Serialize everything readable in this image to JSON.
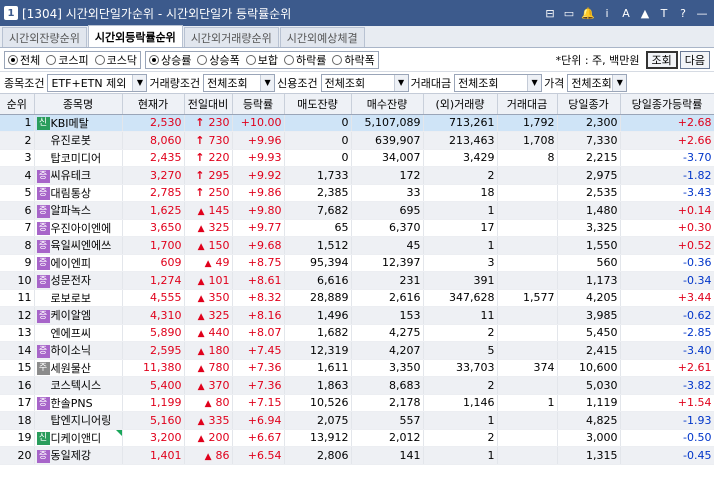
{
  "window": {
    "icon_label": "1",
    "title": "[1304] 시간외단일가순위 - 시간외단일가 등락률순위",
    "buttons": [
      "⊟",
      "▭",
      "🔔",
      "i",
      "A",
      "▲",
      "T",
      "?",
      "—"
    ]
  },
  "tabs": [
    {
      "label": "시간외잔량순위",
      "active": false
    },
    {
      "label": "시간외등락률순위",
      "active": true
    },
    {
      "label": "시간외거래량순위",
      "active": false
    },
    {
      "label": "시간외예상체결",
      "active": false
    }
  ],
  "market_filter": [
    {
      "label": "전체",
      "on": true
    },
    {
      "label": "코스피",
      "on": false
    },
    {
      "label": "코스닥",
      "on": false
    }
  ],
  "direction_filter": [
    {
      "label": "상승률",
      "on": true
    },
    {
      "label": "상승폭",
      "on": false
    },
    {
      "label": "보합",
      "on": false
    },
    {
      "label": "하락률",
      "on": false
    },
    {
      "label": "하락폭",
      "on": false
    }
  ],
  "unit_text": "*단위 : 주, 백만원",
  "query_button": "조회",
  "next_button": "다음",
  "conditions": {
    "item_label": "종목조건",
    "item_value": "ETF+ETN 제외",
    "volume_label": "거래량조건",
    "volume_value": "전체조회",
    "credit_label": "신용조건",
    "credit_value": "전체조회",
    "amount_label": "거래대금",
    "amount_value": "전체조회",
    "price_label": "가격",
    "price_value": "전체조회"
  },
  "columns": [
    "순위",
    "종목명",
    "현재가",
    "전일대비",
    "등락률",
    "매도잔량",
    "매수잔량",
    "(외)거래량",
    "거래대금",
    "당일종가",
    "당일종가등락률"
  ],
  "rows": [
    {
      "rank": "1",
      "badge": "신",
      "name": "KBI메탈",
      "price": "2,530",
      "sym": "↑",
      "change": "230",
      "rate": "+10.00",
      "ask": "0",
      "bid": "5,107,089",
      "vol": "713,261",
      "amt": "1,792",
      "close": "2,300",
      "crate": "+2.68",
      "cdir": "up"
    },
    {
      "rank": "2",
      "badge": "",
      "name": "유진로봇",
      "price": "8,060",
      "sym": "↑",
      "change": "730",
      "rate": "+9.96",
      "ask": "0",
      "bid": "639,907",
      "vol": "213,463",
      "amt": "1,708",
      "close": "7,330",
      "crate": "+2.66",
      "cdir": "up"
    },
    {
      "rank": "3",
      "badge": "",
      "name": "탑코미디어",
      "price": "2,435",
      "sym": "↑",
      "change": "220",
      "rate": "+9.93",
      "ask": "0",
      "bid": "34,007",
      "vol": "3,429",
      "amt": "8",
      "close": "2,215",
      "crate": "-3.70",
      "cdir": "dn"
    },
    {
      "rank": "4",
      "badge": "증",
      "name": "씨유테크",
      "price": "3,270",
      "sym": "↑",
      "change": "295",
      "rate": "+9.92",
      "ask": "1,733",
      "bid": "172",
      "vol": "2",
      "amt": "",
      "close": "2,975",
      "crate": "-1.82",
      "cdir": "dn"
    },
    {
      "rank": "5",
      "badge": "증",
      "name": "대림통상",
      "price": "2,785",
      "sym": "↑",
      "change": "250",
      "rate": "+9.86",
      "ask": "2,385",
      "bid": "33",
      "vol": "18",
      "amt": "",
      "close": "2,535",
      "crate": "-3.43",
      "cdir": "dn"
    },
    {
      "rank": "6",
      "badge": "증",
      "name": "알파녹스",
      "price": "1,625",
      "sym": "▲",
      "change": "145",
      "rate": "+9.80",
      "ask": "7,682",
      "bid": "695",
      "vol": "1",
      "amt": "",
      "close": "1,480",
      "crate": "+0.14",
      "cdir": "up"
    },
    {
      "rank": "7",
      "badge": "증",
      "name": "우진아이엔에",
      "price": "3,650",
      "sym": "▲",
      "change": "325",
      "rate": "+9.77",
      "ask": "65",
      "bid": "6,370",
      "vol": "17",
      "amt": "",
      "close": "3,325",
      "crate": "+0.30",
      "cdir": "up"
    },
    {
      "rank": "8",
      "badge": "증",
      "name": "육일씨엔에쓰",
      "price": "1,700",
      "sym": "▲",
      "change": "150",
      "rate": "+9.68",
      "ask": "1,512",
      "bid": "45",
      "vol": "1",
      "amt": "",
      "close": "1,550",
      "crate": "+0.52",
      "cdir": "up"
    },
    {
      "rank": "9",
      "badge": "증",
      "name": "에이엔피",
      "price": "609",
      "sym": "▲",
      "change": "49",
      "rate": "+8.75",
      "ask": "95,394",
      "bid": "12,397",
      "vol": "3",
      "amt": "",
      "close": "560",
      "crate": "-0.36",
      "cdir": "dn"
    },
    {
      "rank": "10",
      "badge": "증",
      "name": "성문전자",
      "price": "1,274",
      "sym": "▲",
      "change": "101",
      "rate": "+8.61",
      "ask": "6,616",
      "bid": "231",
      "vol": "391",
      "amt": "",
      "close": "1,173",
      "crate": "-0.34",
      "cdir": "dn"
    },
    {
      "rank": "11",
      "badge": "",
      "name": "로보로보",
      "price": "4,555",
      "sym": "▲",
      "change": "350",
      "rate": "+8.32",
      "ask": "28,889",
      "bid": "2,616",
      "vol": "347,628",
      "amt": "1,577",
      "close": "4,205",
      "crate": "+3.44",
      "cdir": "up"
    },
    {
      "rank": "12",
      "badge": "증",
      "name": "케이알엠",
      "price": "4,310",
      "sym": "▲",
      "change": "325",
      "rate": "+8.16",
      "ask": "1,496",
      "bid": "153",
      "vol": "11",
      "amt": "",
      "close": "3,985",
      "crate": "-0.62",
      "cdir": "dn"
    },
    {
      "rank": "13",
      "badge": "",
      "name": "엔에프씨",
      "price": "5,890",
      "sym": "▲",
      "change": "440",
      "rate": "+8.07",
      "ask": "1,682",
      "bid": "4,275",
      "vol": "2",
      "amt": "",
      "close": "5,450",
      "crate": "-2.85",
      "cdir": "dn"
    },
    {
      "rank": "14",
      "badge": "증",
      "name": "하이소닉",
      "price": "2,595",
      "sym": "▲",
      "change": "180",
      "rate": "+7.45",
      "ask": "12,319",
      "bid": "4,207",
      "vol": "5",
      "amt": "",
      "close": "2,415",
      "crate": "-3.40",
      "cdir": "dn"
    },
    {
      "rank": "15",
      "badge": "주",
      "name": "세원물산",
      "price": "11,380",
      "sym": "▲",
      "change": "780",
      "rate": "+7.36",
      "ask": "1,611",
      "bid": "3,350",
      "vol": "33,703",
      "amt": "374",
      "close": "10,600",
      "crate": "+2.61",
      "cdir": "up"
    },
    {
      "rank": "16",
      "badge": "",
      "name": "코스텍시스",
      "price": "5,400",
      "sym": "▲",
      "change": "370",
      "rate": "+7.36",
      "ask": "1,863",
      "bid": "8,683",
      "vol": "2",
      "amt": "",
      "close": "5,030",
      "crate": "-3.82",
      "cdir": "dn"
    },
    {
      "rank": "17",
      "badge": "증",
      "name": "한솔PNS",
      "price": "1,199",
      "sym": "▲",
      "change": "80",
      "rate": "+7.15",
      "ask": "10,526",
      "bid": "2,178",
      "vol": "1,146",
      "amt": "1",
      "close": "1,119",
      "crate": "+1.54",
      "cdir": "up"
    },
    {
      "rank": "18",
      "badge": "",
      "name": "탑엔지니어링",
      "price": "5,160",
      "sym": "▲",
      "change": "335",
      "rate": "+6.94",
      "ask": "2,075",
      "bid": "557",
      "vol": "1",
      "amt": "",
      "close": "4,825",
      "crate": "-1.93",
      "cdir": "dn"
    },
    {
      "rank": "19",
      "badge": "신",
      "name": "디케이앤디",
      "price": "3,200",
      "sym": "▲",
      "change": "200",
      "rate": "+6.67",
      "ask": "13,912",
      "bid": "2,012",
      "vol": "2",
      "amt": "",
      "close": "3,000",
      "crate": "-0.50",
      "cdir": "dn",
      "corner": true
    },
    {
      "rank": "20",
      "badge": "증",
      "name": "동일제강",
      "price": "1,401",
      "sym": "▲",
      "change": "86",
      "rate": "+6.54",
      "ask": "2,806",
      "bid": "141",
      "vol": "1",
      "amt": "",
      "close": "1,315",
      "crate": "-0.45",
      "cdir": "dn"
    }
  ]
}
